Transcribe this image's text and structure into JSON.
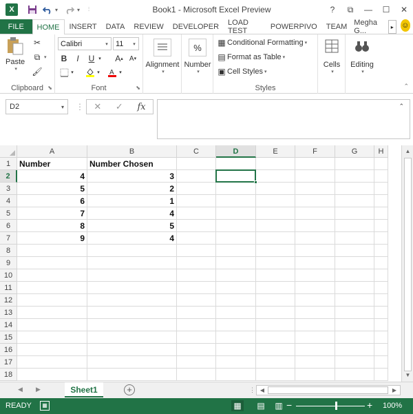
{
  "titlebar": {
    "app_icon": "X",
    "save_icon": "save-icon",
    "undo_icon": "undo-icon",
    "redo_icon": "redo-icon",
    "title": "Book1 - Microsoft Excel Preview",
    "help": "?",
    "restore": "⧉",
    "minimize": "—",
    "maximize": "☐",
    "close": "✕"
  },
  "tabs": {
    "file": "FILE",
    "items": [
      "HOME",
      "INSERT",
      "DATA",
      "REVIEW",
      "DEVELOPER",
      "LOAD TEST",
      "POWERPIVO",
      "TEAM"
    ],
    "account": "Megha G..."
  },
  "ribbon": {
    "clipboard": {
      "paste": "Paste",
      "label": "Clipboard"
    },
    "font": {
      "name": "Calibri",
      "size": "11",
      "bold": "B",
      "italic": "I",
      "underline": "U",
      "grow": "A",
      "shrink": "A",
      "label": "Font"
    },
    "alignment": {
      "label": "Alignment"
    },
    "number": {
      "label": "Number",
      "icon": "%"
    },
    "styles": {
      "conditional": "Conditional Formatting",
      "format_table": "Format as Table",
      "cell_styles": "Cell Styles",
      "label": "Styles"
    },
    "cells": {
      "label": "Cells"
    },
    "editing": {
      "label": "Editing"
    }
  },
  "formula_bar": {
    "name_box": "D2",
    "cancel": "✕",
    "enter": "✓",
    "fx": "fx",
    "value": ""
  },
  "grid": {
    "columns": [
      "A",
      "B",
      "C",
      "D",
      "E",
      "F",
      "G",
      "H"
    ],
    "rows": [
      "1",
      "2",
      "3",
      "4",
      "5",
      "6",
      "7",
      "8",
      "9",
      "10",
      "11",
      "12",
      "13",
      "14",
      "15",
      "16",
      "17",
      "18"
    ],
    "header": [
      "Number",
      "Number Chosen"
    ],
    "data": [
      [
        "4",
        "3"
      ],
      [
        "5",
        "2"
      ],
      [
        "6",
        "1"
      ],
      [
        "7",
        "4"
      ],
      [
        "8",
        "5"
      ],
      [
        "9",
        "4"
      ]
    ],
    "active_cell": "D2",
    "active_col": "D",
    "active_row": "2"
  },
  "sheets": {
    "tabs": [
      "Sheet1"
    ],
    "add": "⊕"
  },
  "statusbar": {
    "ready": "READY",
    "zoom": "100%",
    "minus": "−",
    "plus": "+"
  }
}
